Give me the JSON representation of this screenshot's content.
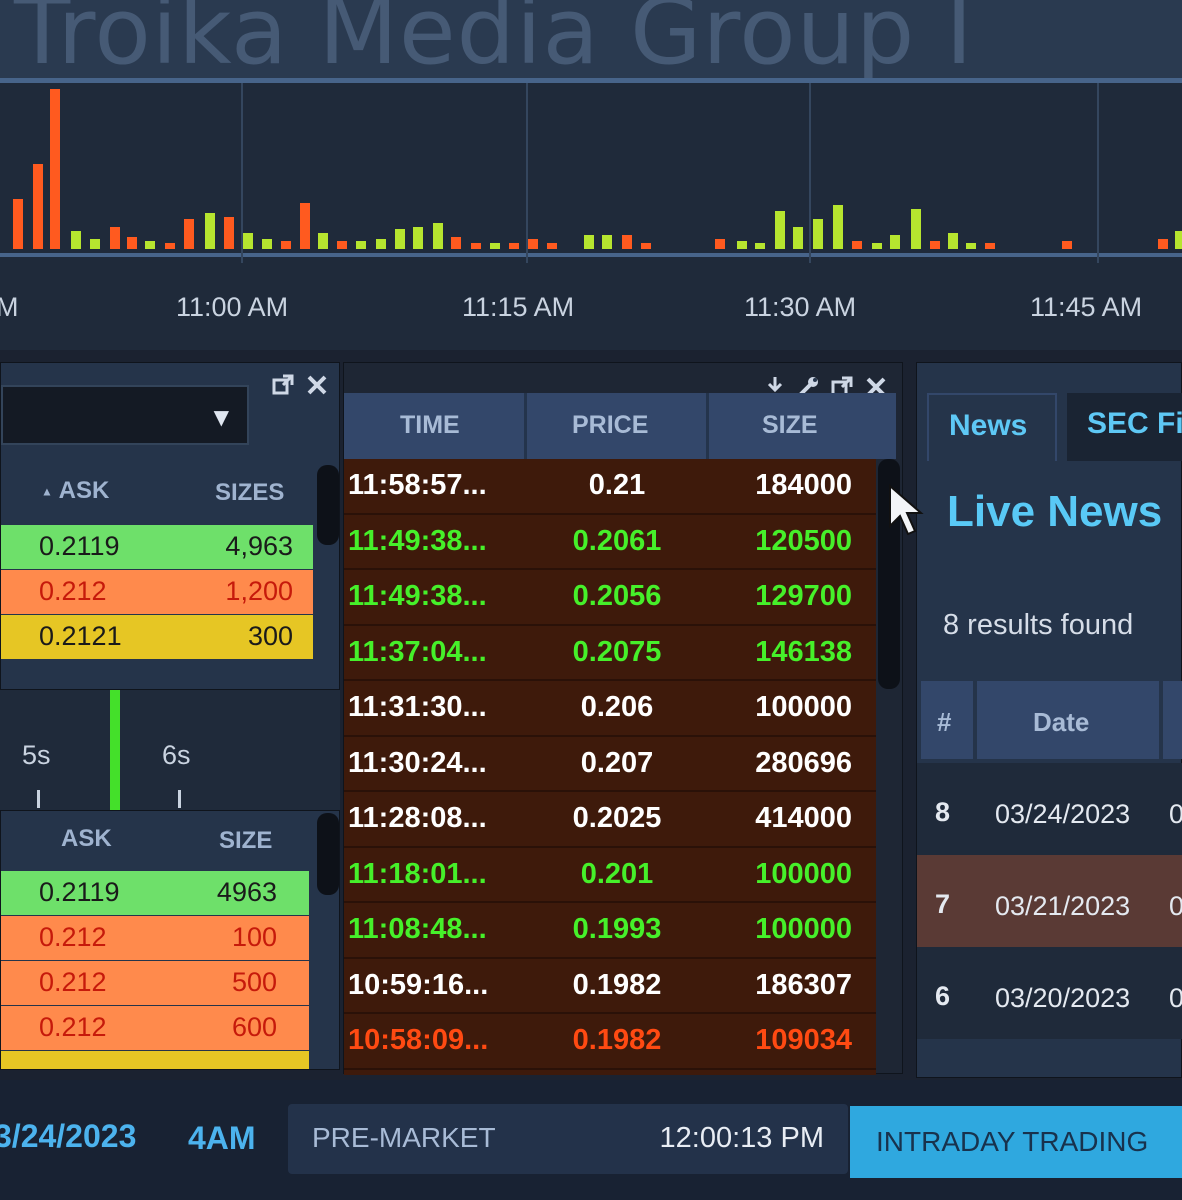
{
  "chart": {
    "title": "Troika Media Group I",
    "time_ticks": [
      "M",
      "11:00 AM",
      "11:15 AM",
      "11:30 AM",
      "11:45 AM"
    ],
    "colors": {
      "up": "#b6e52f",
      "down": "#ff5a1f"
    }
  },
  "level2": {
    "ask_header": "ASK",
    "sizes_header": "SIZES",
    "sort_indicator": "▲",
    "rows": [
      {
        "ask": "0.2119",
        "size": "4,963",
        "color": "#6ee06a"
      },
      {
        "ask": "0.212",
        "size": "1,200",
        "color": "#ff8a4c"
      },
      {
        "ask": "0.2121",
        "size": "300",
        "color": "#e6c624"
      }
    ]
  },
  "timer": {
    "labels": [
      "5s",
      "6s"
    ]
  },
  "ask_panel": {
    "ask_header": "ASK",
    "size_header": "SIZE",
    "rows": [
      {
        "ask": "0.2119",
        "size": "4963",
        "color": "#6ee06a",
        "text": "#1a1a1a"
      },
      {
        "ask": "0.212",
        "size": "100",
        "color": "#ff8a4c",
        "text": "#c61a0b"
      },
      {
        "ask": "0.212",
        "size": "500",
        "color": "#ff8a4c",
        "text": "#c61a0b"
      },
      {
        "ask": "0.212",
        "size": "600",
        "color": "#ff8a4c",
        "text": "#c61a0b"
      }
    ]
  },
  "time_sales": {
    "headers": {
      "time": "TIME",
      "price": "PRICE",
      "size": "SIZE"
    },
    "icons": [
      "download-icon",
      "wrench-icon",
      "popout-icon",
      "close-icon"
    ],
    "rows": [
      {
        "time": "11:58:57...",
        "price": "0.21",
        "size": "184000",
        "color": "#ffffff"
      },
      {
        "time": "11:49:38...",
        "price": "0.2061",
        "size": "120500",
        "color": "#46f02a"
      },
      {
        "time": "11:49:38...",
        "price": "0.2056",
        "size": "129700",
        "color": "#46f02a"
      },
      {
        "time": "11:37:04...",
        "price": "0.2075",
        "size": "146138",
        "color": "#46f02a"
      },
      {
        "time": "11:31:30...",
        "price": "0.206",
        "size": "100000",
        "color": "#ffffff"
      },
      {
        "time": "11:30:24...",
        "price": "0.207",
        "size": "280696",
        "color": "#ffffff"
      },
      {
        "time": "11:28:08...",
        "price": "0.2025",
        "size": "414000",
        "color": "#ffffff"
      },
      {
        "time": "11:18:01...",
        "price": "0.201",
        "size": "100000",
        "color": "#46f02a"
      },
      {
        "time": "11:08:48...",
        "price": "0.1993",
        "size": "100000",
        "color": "#46f02a"
      },
      {
        "time": "10:59:16...",
        "price": "0.1982",
        "size": "186307",
        "color": "#ffffff"
      },
      {
        "time": "10:58:09...",
        "price": "0.1982",
        "size": "109034",
        "color": "#ff4a12"
      }
    ]
  },
  "news": {
    "tabs": [
      "News",
      "SEC Fi"
    ],
    "title": "Live News",
    "results": "8 results found",
    "headers": {
      "num": "#",
      "date": "Date"
    },
    "rows": [
      {
        "num": "8",
        "date": "03/24/2023",
        "extra": "0"
      },
      {
        "num": "7",
        "date": "03/21/2023",
        "extra": "0"
      },
      {
        "num": "6",
        "date": "03/20/2023",
        "extra": "0"
      }
    ]
  },
  "status": {
    "date": "3/24/2023",
    "session_start": "4AM",
    "premarket": "PRE-MARKET",
    "clock": "12:00:13 PM",
    "intraday": "INTRADAY TRADING"
  }
}
